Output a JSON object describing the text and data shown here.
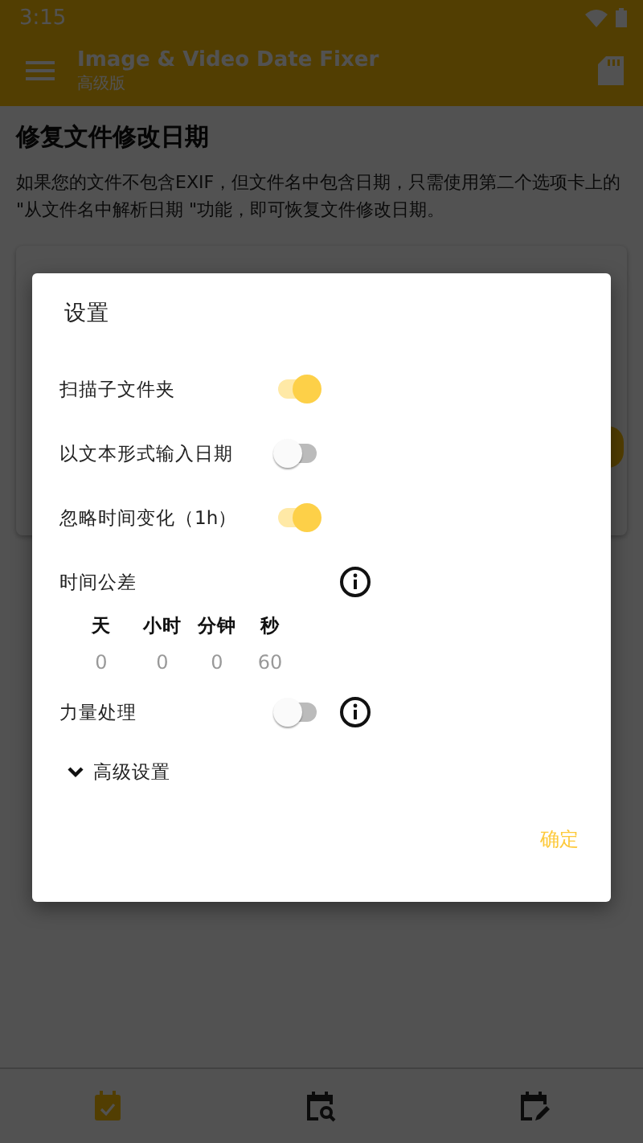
{
  "status_bar": {
    "time": "3:15"
  },
  "app_bar": {
    "title": "Image & Video Date Fixer",
    "subtitle": "高级版"
  },
  "page": {
    "heading": "修复文件修改日期",
    "description": "如果您的文件不包含EXIF，但文件名中包含日期，只需使用第二个选项卡上的 \"从文件名中解析日期 \"功能，即可恢复文件修改日期。"
  },
  "dialog": {
    "title": "设置",
    "settings": [
      {
        "kind": "switch",
        "label": "扫描子文件夹",
        "on": true,
        "info": false
      },
      {
        "kind": "switch",
        "label": "以文本形式输入日期",
        "on": false,
        "info": false
      },
      {
        "kind": "switch",
        "label": "忽略时间变化（1h）",
        "on": true,
        "info": false
      },
      {
        "kind": "heading",
        "label": "时间公差",
        "info": true
      }
    ],
    "tolerance": [
      {
        "unit": "天",
        "value": "0"
      },
      {
        "unit": "小时",
        "value": "0"
      },
      {
        "unit": "分钟",
        "value": "0"
      },
      {
        "unit": "秒",
        "value": "60"
      }
    ],
    "force": {
      "label": "力量处理",
      "on": false,
      "info": true
    },
    "advanced": {
      "label": "高级设置",
      "expanded": false
    },
    "button": "确定"
  },
  "bottom_nav": [
    {
      "selected": true
    },
    {
      "selected": false
    },
    {
      "selected": false
    }
  ]
}
